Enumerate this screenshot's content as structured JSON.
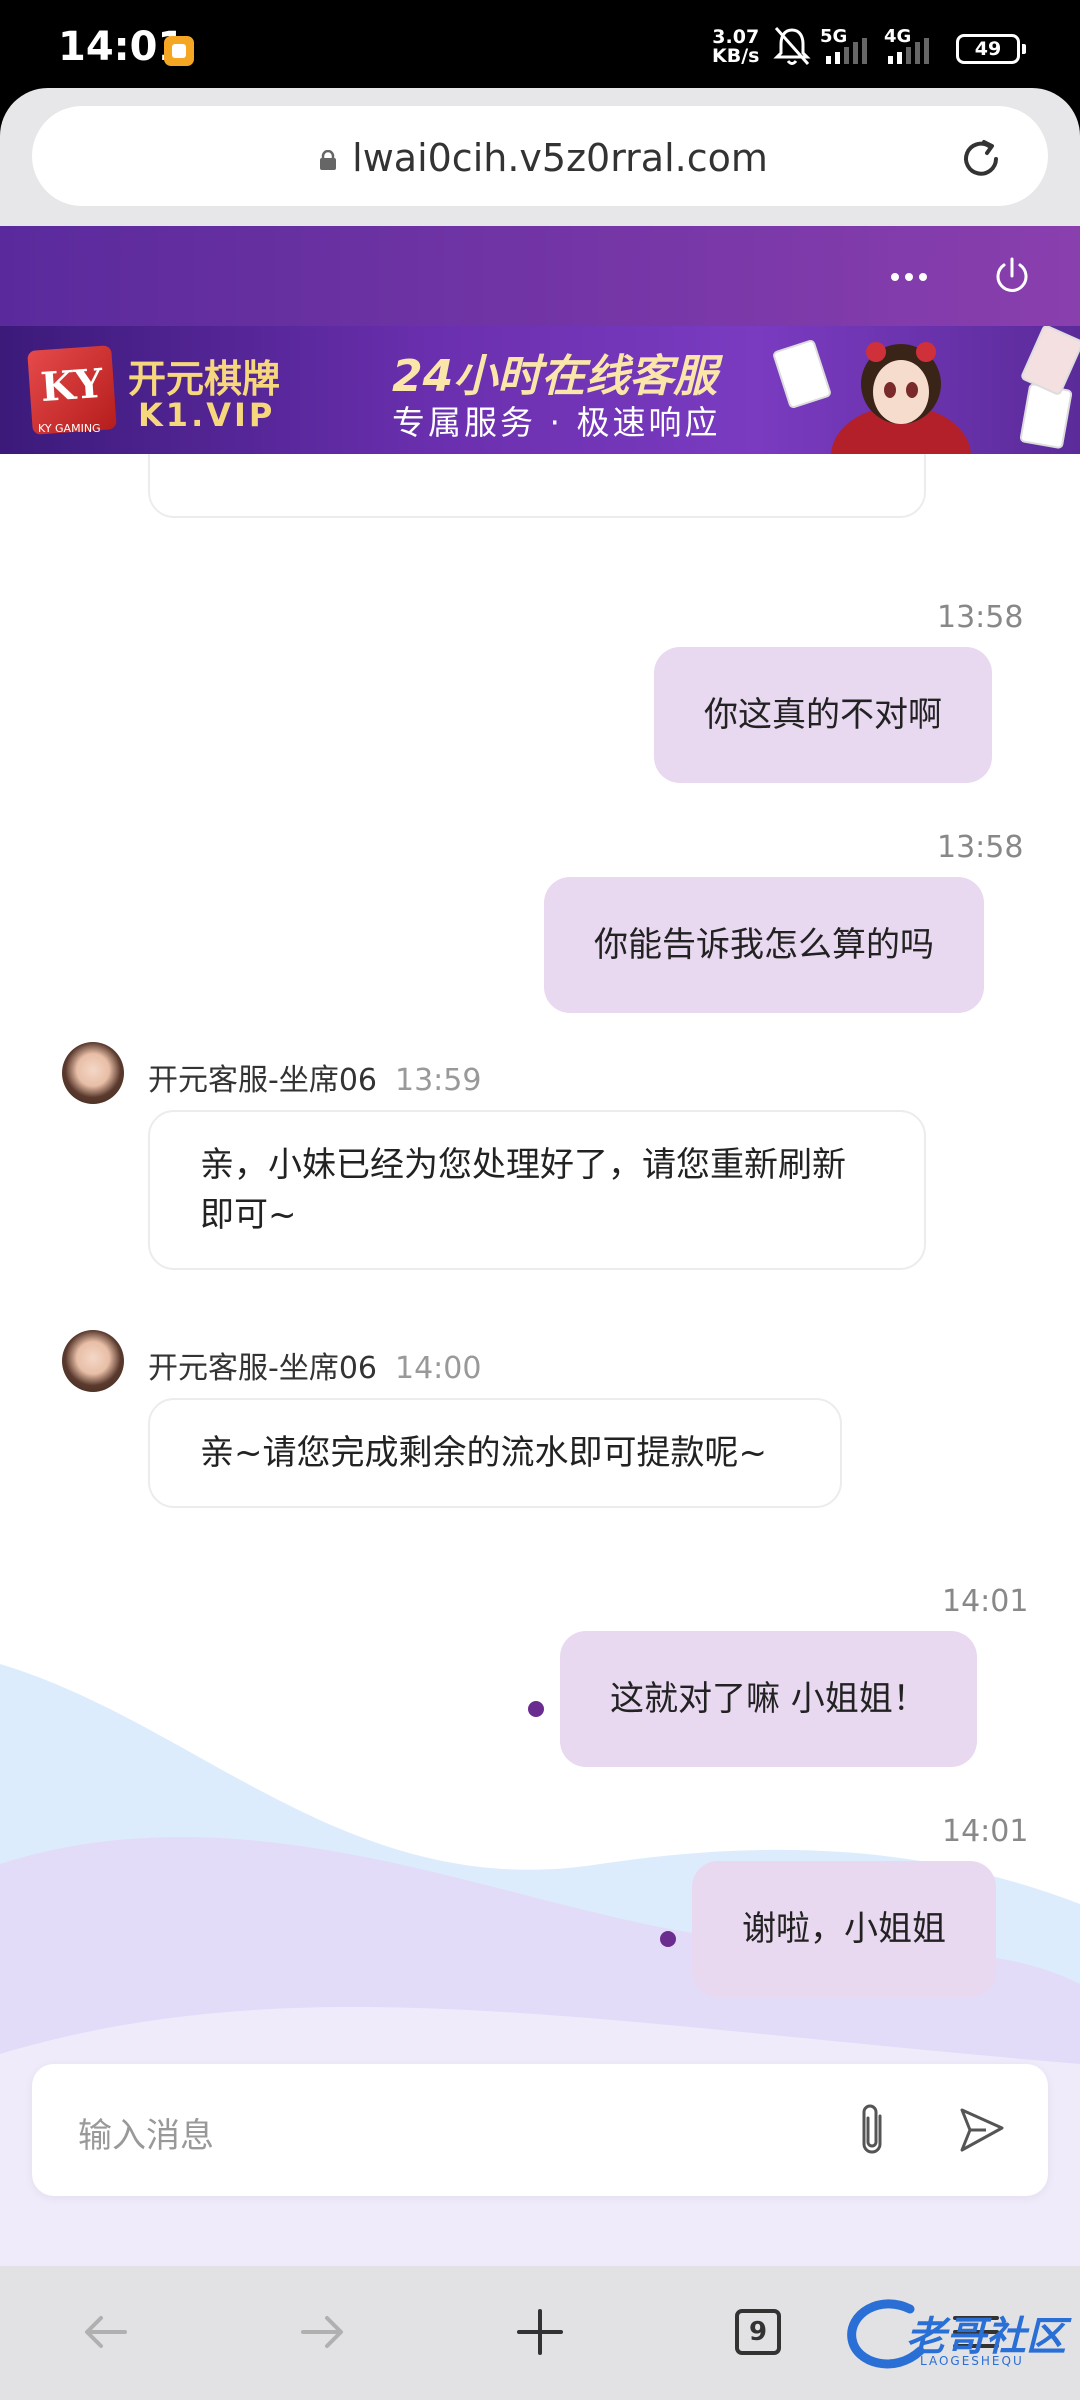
{
  "status": {
    "time": "14:01",
    "speed_value": "3.07",
    "speed_unit": "KB/s",
    "sim1": "5G",
    "sim2": "4G",
    "battery": "49"
  },
  "browser": {
    "url": "lwai0cih.v5z0rral.com",
    "tabs_count": "9"
  },
  "banner": {
    "logo_text": "KY",
    "logo_sub": "KY GAMING",
    "brand_name": "开元棋牌",
    "brand_site": "K1.VIP",
    "title": "24小时在线客服",
    "subtitle": "专属服务 · 极速响应"
  },
  "messages": {
    "m1": {
      "time": "13:58",
      "text": "你这真的不对啊"
    },
    "m2": {
      "time": "13:58",
      "text": "你能告诉我怎么算的吗"
    },
    "m3": {
      "agent": "开元客服-坐席06",
      "time": "13:59",
      "text": "亲，小妹已经为您处理好了，请您重新刷新即可~"
    },
    "m4": {
      "agent": "开元客服-坐席06",
      "time": "14:00",
      "text": "亲~请您完成剩余的流水即可提款呢~"
    },
    "m5": {
      "time": "14:01",
      "text": "这就对了嘛 小姐姐！"
    },
    "m6": {
      "time": "14:01",
      "text": "谢啦，小姐姐"
    }
  },
  "input": {
    "placeholder": "输入消息"
  },
  "watermark": {
    "text": "老哥社区",
    "sub": "LAOGESHEQU"
  },
  "colors": {
    "header_purple": "#5a2a9c",
    "outgoing_bubble": "#e8d8f0",
    "unread_dot": "#6b2c8f"
  }
}
